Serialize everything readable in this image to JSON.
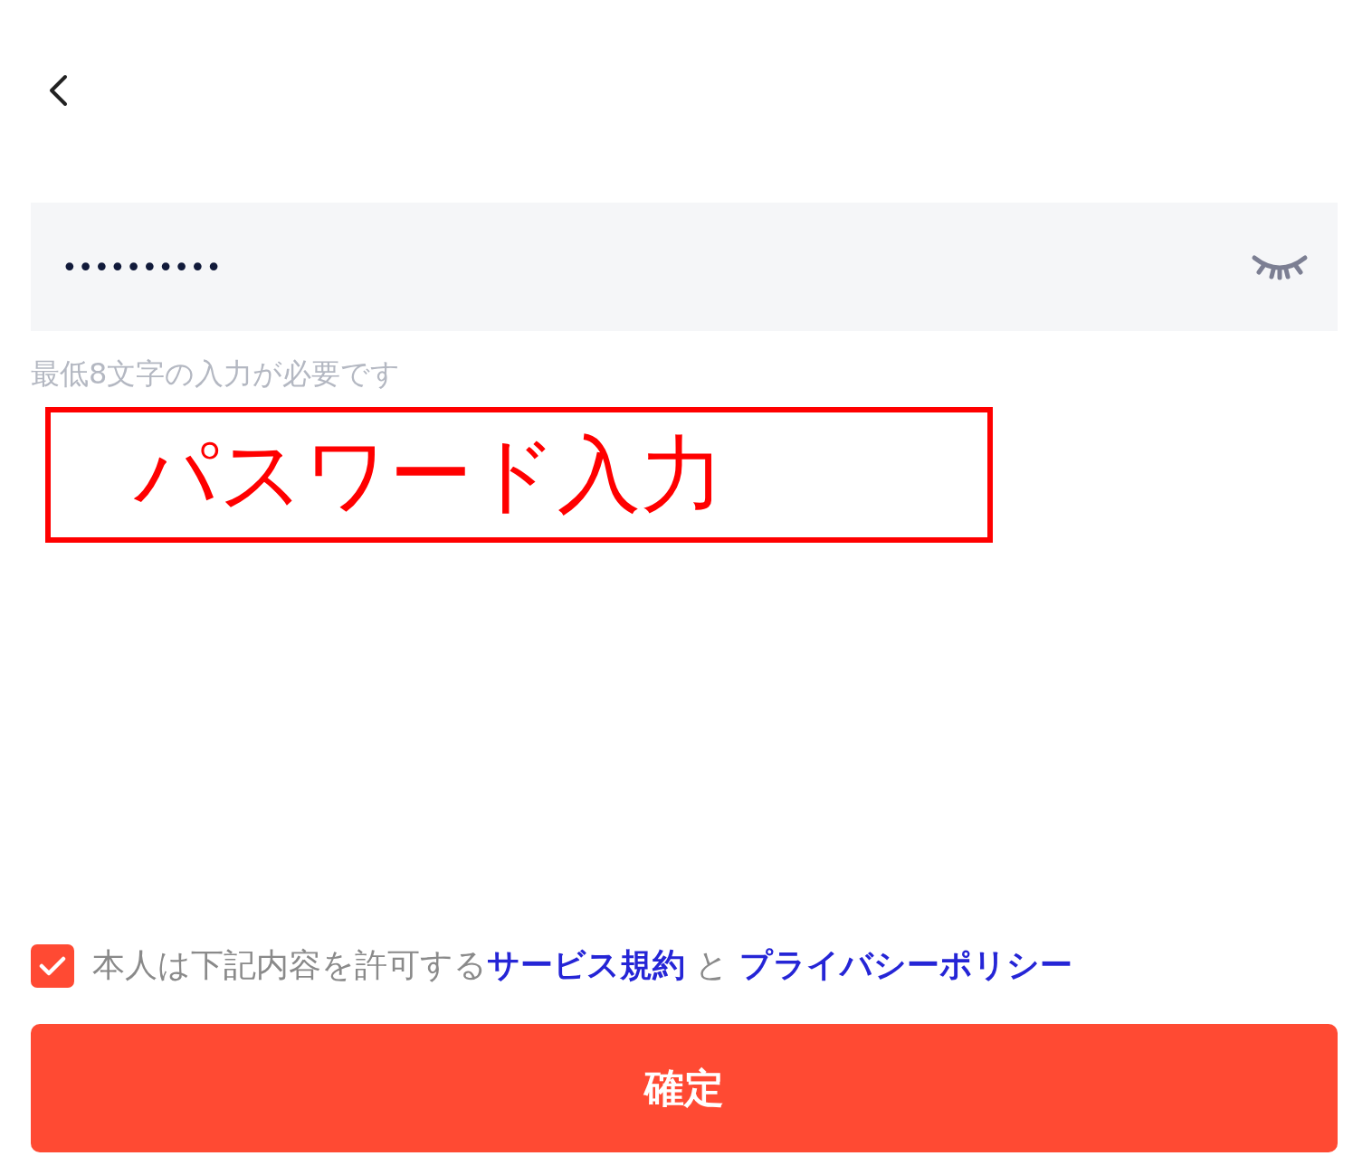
{
  "password_field": {
    "value": "••••••••••",
    "revealed": false
  },
  "hint": "最低8文字の入力が必要です",
  "annotation": "パスワード入力",
  "agreement": {
    "checked": true,
    "text": "本人は下記内容を許可する",
    "links": [
      "サービス規約",
      "プライバシーポリシー"
    ],
    "joiner": "と"
  },
  "confirm_button": "確定"
}
